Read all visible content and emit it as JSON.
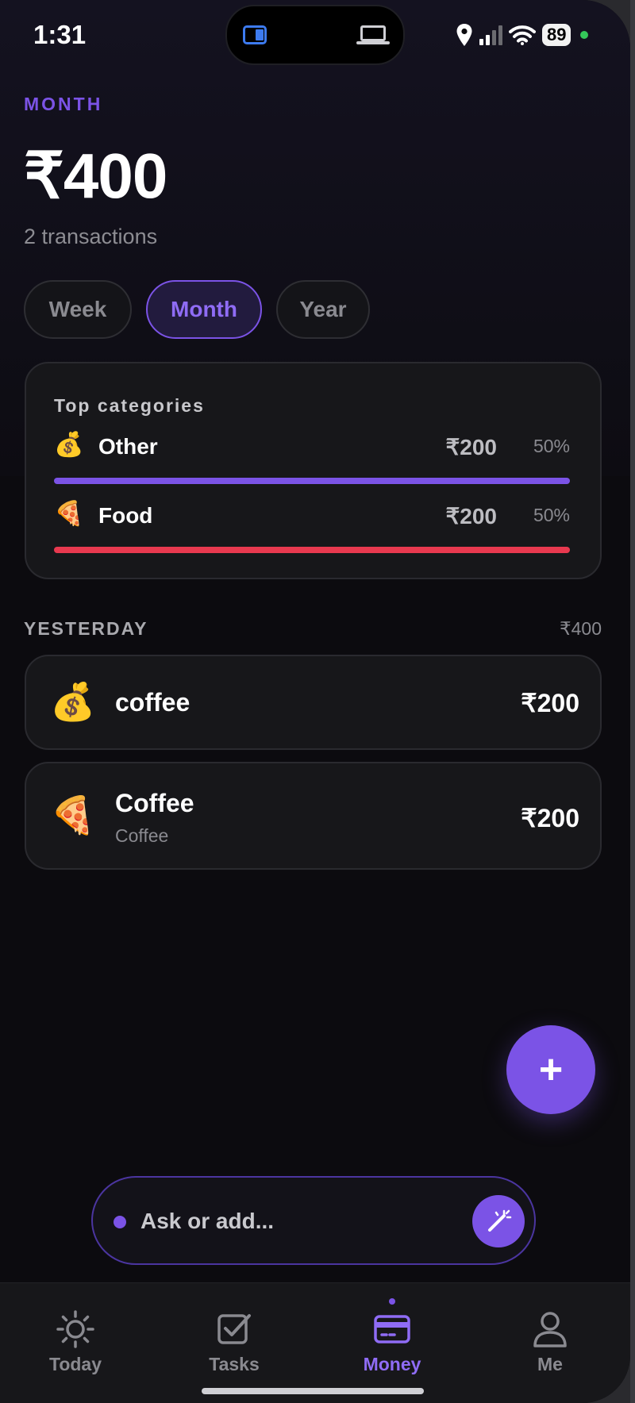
{
  "status_bar": {
    "time": "1:31",
    "battery": "89"
  },
  "summary": {
    "period_label": "MONTH",
    "total": "₹400",
    "count": "2 transactions"
  },
  "period_pills": [
    {
      "label": "Week",
      "active": false
    },
    {
      "label": "Month",
      "active": true
    },
    {
      "label": "Year",
      "active": false
    }
  ],
  "top_categories": {
    "title": "Top categories",
    "items": [
      {
        "emoji": "💰",
        "name": "Other",
        "amount": "₹200",
        "percent": "50%",
        "share": 0.5,
        "color": "#7b53e6"
      },
      {
        "emoji": "🍕",
        "name": "Food",
        "amount": "₹200",
        "percent": "50%",
        "share": 0.5,
        "color": "#e8394f"
      }
    ]
  },
  "day_group": {
    "label": "YESTERDAY",
    "total": "₹400",
    "transactions": [
      {
        "emoji": "💰",
        "title": "coffee",
        "subtitle": "",
        "amount": "₹200"
      },
      {
        "emoji": "🍕",
        "title": "Coffee",
        "subtitle": "Coffee",
        "amount": "₹200"
      }
    ]
  },
  "fab_label": "+",
  "ask_bar": {
    "placeholder": "Ask or add..."
  },
  "tabs": [
    {
      "label": "Today",
      "icon": "sun-icon",
      "active": false
    },
    {
      "label": "Tasks",
      "icon": "checkbox-icon",
      "active": false
    },
    {
      "label": "Money",
      "icon": "wallet-icon",
      "active": true
    },
    {
      "label": "Me",
      "icon": "person-icon",
      "active": false
    }
  ],
  "colors": {
    "accent": "#7b53e6",
    "food": "#e8394f",
    "background": "#0c0b0f"
  }
}
